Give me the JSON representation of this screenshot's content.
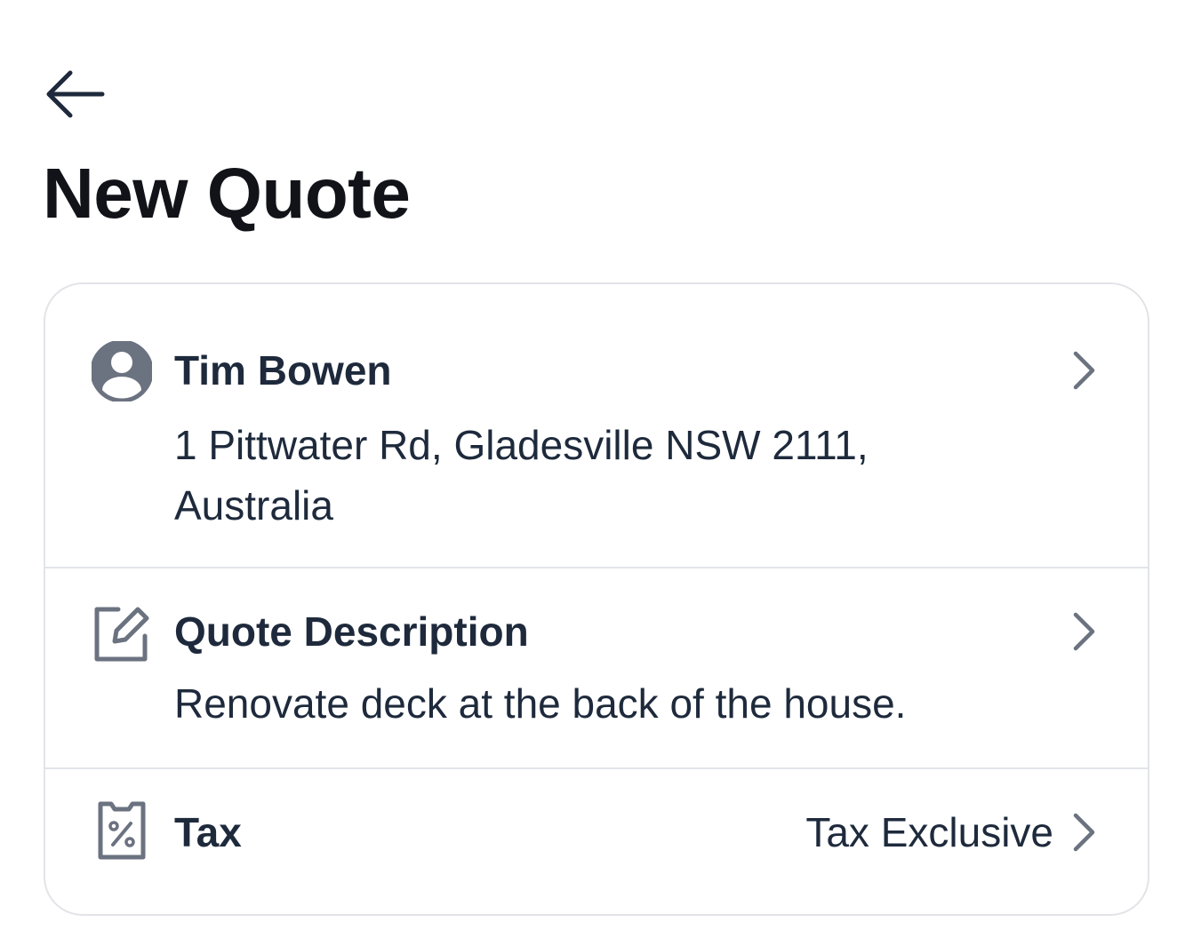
{
  "header": {
    "back_icon": "arrow-left-icon",
    "title": "New Quote"
  },
  "card": {
    "customer": {
      "icon": "user-circle-icon",
      "name": "Tim Bowen",
      "address": "1 Pittwater Rd, Gladesville NSW 2111, Australia",
      "chevron_icon": "chevron-right-icon"
    },
    "description": {
      "icon": "edit-note-icon",
      "label": "Quote Description",
      "text": "Renovate deck at the back of the house.",
      "chevron_icon": "chevron-right-icon"
    },
    "tax": {
      "icon": "tax-receipt-icon",
      "label": "Tax",
      "value": "Tax Exclusive",
      "chevron_icon": "chevron-right-icon"
    }
  },
  "colors": {
    "text_dark": "#111318",
    "text_navy": "#1e2a3c",
    "icon_gray": "#6b7280",
    "border": "#e2e4e8"
  }
}
